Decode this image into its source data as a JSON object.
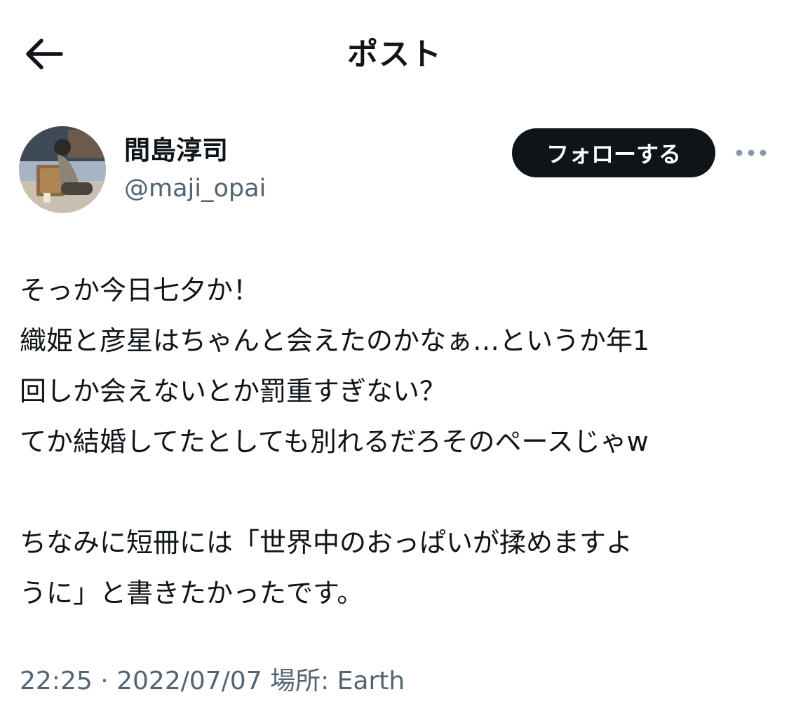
{
  "header": {
    "back_icon": "arrow-left-icon",
    "title": "ポスト"
  },
  "author": {
    "display_name": "間島淳司",
    "handle": "@maji_opai",
    "avatar_icon": "profile-photo"
  },
  "actions": {
    "follow_label": "フォローする",
    "more_icon": "more-horizontal-icon"
  },
  "tweet": {
    "lines": [
      "そっか今日七夕か！",
      "織姫と彦星はちゃんと会えたのかなぁ…というか年1",
      "回しか会えないとか罰重すぎない？",
      "てか結婚してたとしても別れるだろそのペースじゃw",
      "",
      "ちなみに短冊には「世界中のおっぱいが揉めますよ",
      "うに」と書きたかったです。"
    ]
  },
  "meta": {
    "time": "22:25",
    "separator": "·",
    "date": "2022/07/07",
    "location": "場所: Earth"
  },
  "colors": {
    "text": "#0f1419",
    "secondary": "#536471",
    "button_bg": "#0f1419",
    "button_text": "#ffffff"
  }
}
